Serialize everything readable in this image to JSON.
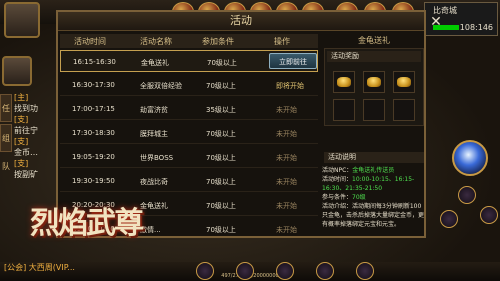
{
  "panel": {
    "title": "活动",
    "close_icon": "close-icon"
  },
  "left_rail": [
    "任务",
    "组队"
  ],
  "left_list": [
    "[主]",
    "找到功",
    "[支]",
    "前往宁",
    "[支]",
    "金币…",
    "[支]",
    "按副矿"
  ],
  "minimap": {
    "city": "比奇城",
    "coords": "108:146"
  },
  "table": {
    "headers": [
      "活动时间",
      "活动名称",
      "参加条件",
      "操作"
    ],
    "rows": [
      {
        "time": "16:15-16:30",
        "name": "金龟送礼",
        "cond": "70级以上",
        "action": "立即前往",
        "state": "button"
      },
      {
        "time": "16:30-17:30",
        "name": "全服双倍经验",
        "cond": "70级以上",
        "action": "即将开始",
        "state": "soon"
      },
      {
        "time": "17:00-17:15",
        "name": "劫富济贫",
        "cond": "35级以上",
        "action": "未开始",
        "state": "pending"
      },
      {
        "time": "17:30-18:30",
        "name": "膜拜城主",
        "cond": "70级以上",
        "action": "未开始",
        "state": "pending"
      },
      {
        "time": "19:05-19:20",
        "name": "世界BOSS",
        "cond": "70级以上",
        "action": "未开始",
        "state": "pending"
      },
      {
        "time": "19:30-19:50",
        "name": "夜战比奇",
        "cond": "70级以上",
        "action": "未开始",
        "state": "pending"
      },
      {
        "time": "20:20-20:30",
        "name": "金龟送礼",
        "cond": "70级以上",
        "action": "未开始",
        "state": "pending"
      },
      {
        "time": "20:30-21:00",
        "name": "激情...",
        "cond": "70级以上",
        "action": "未开始",
        "state": "pending"
      }
    ]
  },
  "right": {
    "title": "金龟送礼",
    "reward_label": "活动奖励",
    "desc_label": "活动说明",
    "npc_label": "活动NPC：",
    "npc_value": "金龟送礼传送员",
    "time_label": "活动时间：",
    "time_value": "10:00-10:15、16:15-16:30、21:35-21:50",
    "cond_label": "参与条件：",
    "cond_value": "70级",
    "intro_label": "活动介绍：",
    "intro_value": "活动期间每3分钟刷新100只金龟，击杀后掉落大量绑定金币，更有概率掉落绑定元宝和元宝。"
  },
  "logo": "烈焰武尊",
  "chat": "[公会] 大西周(VIP...",
  "exp_text": "497/278561/20000000",
  "colors": {
    "gold": "#c5a050",
    "green": "#4fe04f",
    "orange": "#ffb24a"
  }
}
